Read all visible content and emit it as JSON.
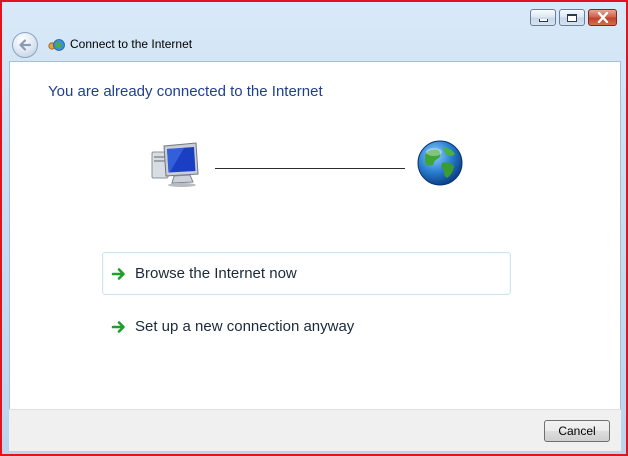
{
  "window": {
    "title": "Connect to the Internet",
    "accent_border": "#e0141c"
  },
  "main": {
    "heading": "You are already connected to the Internet",
    "heading_color": "#1f3f8f",
    "status_icons": [
      "computer-icon",
      "globe-icon"
    ]
  },
  "options": [
    {
      "label": "Browse the Internet now",
      "icon": "green-arrow-icon"
    },
    {
      "label": "Set up a new connection anyway",
      "icon": "green-arrow-icon"
    }
  ],
  "footer": {
    "cancel_label": "Cancel"
  }
}
